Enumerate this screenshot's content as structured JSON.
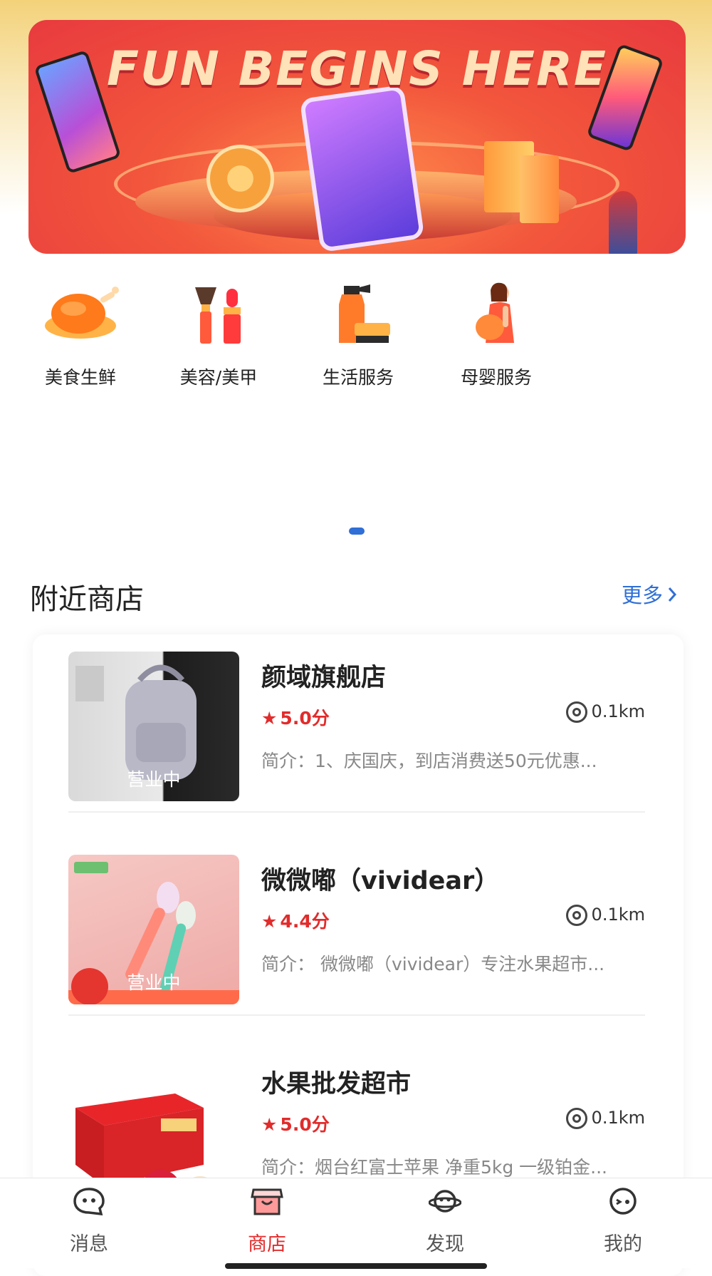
{
  "banner": {
    "headline": "FUN BEGINS HERE",
    "dots": 4,
    "active_dot": 4
  },
  "categories": [
    {
      "label": "美食生鲜",
      "icon": "roast-chicken-icon"
    },
    {
      "label": "美容/美甲",
      "icon": "makeup-brush-lipstick-icon"
    },
    {
      "label": "生活服务",
      "icon": "cleaning-spray-brush-icon"
    },
    {
      "label": "母婴服务",
      "icon": "pregnant-woman-icon"
    }
  ],
  "nearby": {
    "title": "附近商店",
    "more_label": "更多"
  },
  "stores": [
    {
      "name": "颜域旗舰店",
      "rating": "5.0分",
      "distance": "0.1km",
      "description": "简介：1、庆国庆，到店消费送50元优惠...",
      "status": "营业中"
    },
    {
      "name": "微微嘟（vividear）",
      "rating": "4.4分",
      "distance": "0.1km",
      "description": "简介： 微微嘟（vividear）专注水果超市...",
      "status": "营业中"
    },
    {
      "name": "水果批发超市",
      "rating": "5.0分",
      "distance": "0.1km",
      "description": "简介：烟台红富士苹果 净重5kg 一级铂金...",
      "status": ""
    }
  ],
  "tabs": [
    {
      "label": "消息",
      "icon": "chat-face-icon",
      "active": false
    },
    {
      "label": "商店",
      "icon": "shop-icon",
      "active": true
    },
    {
      "label": "发现",
      "icon": "planet-face-icon",
      "active": false
    },
    {
      "label": "我的",
      "icon": "wink-face-icon",
      "active": false
    }
  ],
  "colors": {
    "accent_red": "#e12c2c",
    "link_blue": "#2f6fd6"
  }
}
